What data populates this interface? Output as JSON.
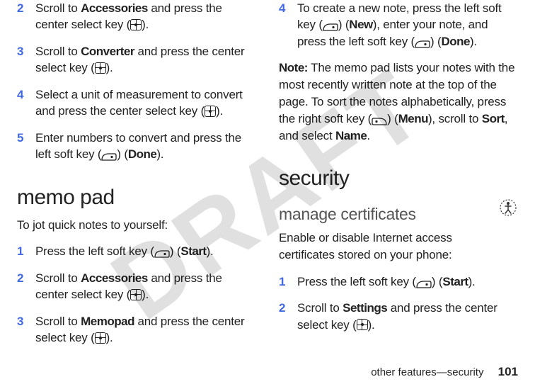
{
  "watermark": "DRAFT",
  "left": {
    "steps_a": [
      {
        "n": "2",
        "pre": "Scroll to ",
        "b": "Accessories",
        "post": " and press the center select key (",
        "icon": "center",
        "tail": ")."
      },
      {
        "n": "3",
        "pre": "Scroll to ",
        "b": "Converter",
        "post": " and press the center select key (",
        "icon": "center",
        "tail": ")."
      },
      {
        "n": "4",
        "pre": "Select a unit of measurement to convert and press the center select key (",
        "b": "",
        "post": "",
        "icon": "center",
        "tail": ")."
      },
      {
        "n": "5",
        "pre": "Enter numbers to convert and press the left soft key (",
        "b": "",
        "post": "",
        "icon": "left",
        "tail": ") (",
        "b2": "Done",
        "tail2": ")."
      }
    ],
    "h1": "memo pad",
    "intro": "To jot quick notes to yourself:",
    "steps_b": [
      {
        "n": "1",
        "pre": "Press the left soft key (",
        "b": "",
        "post": "",
        "icon": "left",
        "tail": ") (",
        "b2": "Start",
        "tail2": ")."
      },
      {
        "n": "2",
        "pre": "Scroll to ",
        "b": "Accessories",
        "post": " and press the center select key (",
        "icon": "center",
        "tail": ")."
      },
      {
        "n": "3",
        "pre": "Scroll to ",
        "b": "Memopad",
        "post": " and press the center select key (",
        "icon": "center",
        "tail": ")."
      }
    ]
  },
  "right": {
    "step4": {
      "n": "4",
      "pre": "To create a new note, press the left soft key (",
      "icon": "left",
      "mid": ") (",
      "b1": "New",
      "mid2": "), enter your note, and press the left soft key (",
      "icon2": "left",
      "mid3": ") (",
      "b2": "Done",
      "tail": ")."
    },
    "note": {
      "label": "Note:",
      "body": " The memo pad lists your notes with the most recently written note at the top of the page. To sort the notes alphabetically, press the right soft key (",
      "icon": "right",
      "mid": ") (",
      "b1": "Menu",
      "mid2": "), scroll to ",
      "b2": "Sort",
      "mid3": ", and select ",
      "b3": "Name",
      "tail": "."
    },
    "h1": "security",
    "h2": "manage certificates",
    "intro": "Enable or disable Internet access certificates stored on your phone:",
    "steps": [
      {
        "n": "1",
        "pre": "Press the left soft key (",
        "b": "",
        "post": "",
        "icon": "left",
        "tail": ") (",
        "b2": "Start",
        "tail2": ")."
      },
      {
        "n": "2",
        "pre": "Scroll to ",
        "b": "Settings",
        "post": " and press the center select key (",
        "icon": "center",
        "tail": ")."
      }
    ]
  },
  "footer": {
    "text": "other features—security",
    "page": "101"
  }
}
